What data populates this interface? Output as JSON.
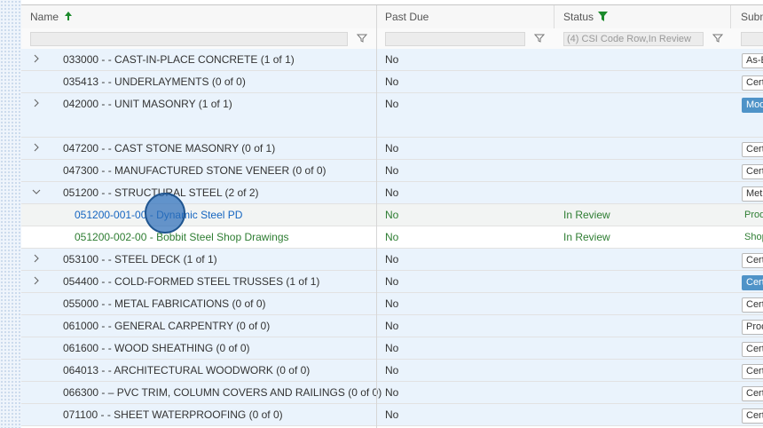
{
  "header": {
    "name_label": "Name",
    "sort_icon": "arrow-up-icon",
    "past_due_label": "Past Due",
    "status_label": "Status",
    "status_filter_icon": "filter-icon",
    "submittal_label": "Subm",
    "sort_color": "#1b8a2b",
    "filter_active_color": "#1b8a2b"
  },
  "filters": {
    "name_value": "",
    "past_due_value": "",
    "status_value": "(4) CSI Code Row,In Review"
  },
  "rows": [
    {
      "name": "033000 - - CAST-IN-PLACE CONCRETE (1 of 1)",
      "past_due": "No",
      "status": "",
      "badge": "As-B"
    },
    {
      "name": "035413 - - UNDERLAYMENTS (0 of 0)",
      "past_due": "No",
      "status": "",
      "badge": "Cert"
    },
    {
      "name": "042000 - - UNIT MASONRY (1 of 1)",
      "past_due": "No",
      "status": "",
      "badge": "Mod"
    },
    {
      "name": "047200 - - CAST STONE MASONRY (0 of 1)",
      "past_due": "No",
      "status": "",
      "badge": "Cert"
    },
    {
      "name": "047300 - - MANUFACTURED STONE VENEER (0 of 0)",
      "past_due": "No",
      "status": "",
      "badge": "Cert"
    },
    {
      "name": "051200 - - STRUCTURAL STEEL (2 of 2)",
      "past_due": "No",
      "status": "",
      "badge": "Met"
    },
    {
      "name": "051200-001-00 - Dynamic Steel PD",
      "past_due": "No",
      "status": "In Review",
      "badge": "Prod"
    },
    {
      "name": "051200-002-00 - Bobbit Steel Shop Drawings",
      "past_due": "No",
      "status": "In Review",
      "badge": "Shop"
    },
    {
      "name": "053100 - - STEEL DECK (1 of 1)",
      "past_due": "No",
      "status": "",
      "badge": "Cert"
    },
    {
      "name": "054400 - - COLD-FORMED STEEL TRUSSES (1 of 1)",
      "past_due": "No",
      "status": "",
      "badge": "Cert"
    },
    {
      "name": "055000 - - METAL FABRICATIONS (0 of 0)",
      "past_due": "No",
      "status": "",
      "badge": "Cert"
    },
    {
      "name": "061000 - - GENERAL CARPENTRY (0 of 0)",
      "past_due": "No",
      "status": "",
      "badge": "Prod"
    },
    {
      "name": "061600 - - WOOD SHEATHING (0 of 0)",
      "past_due": "No",
      "status": "",
      "badge": "Cert"
    },
    {
      "name": "064013 - - ARCHITECTURAL WOODWORK (0 of 0)",
      "past_due": "No",
      "status": "",
      "badge": "Cert"
    },
    {
      "name": "066300 - – PVC TRIM, COLUMN COVERS AND RAILINGS (0 of 0)",
      "past_due": "No",
      "status": "",
      "badge": "Cert"
    },
    {
      "name": "071100 - - SHEET WATERPROOFING (0 of 0)",
      "past_due": "No",
      "status": "",
      "badge": "Cert"
    }
  ]
}
